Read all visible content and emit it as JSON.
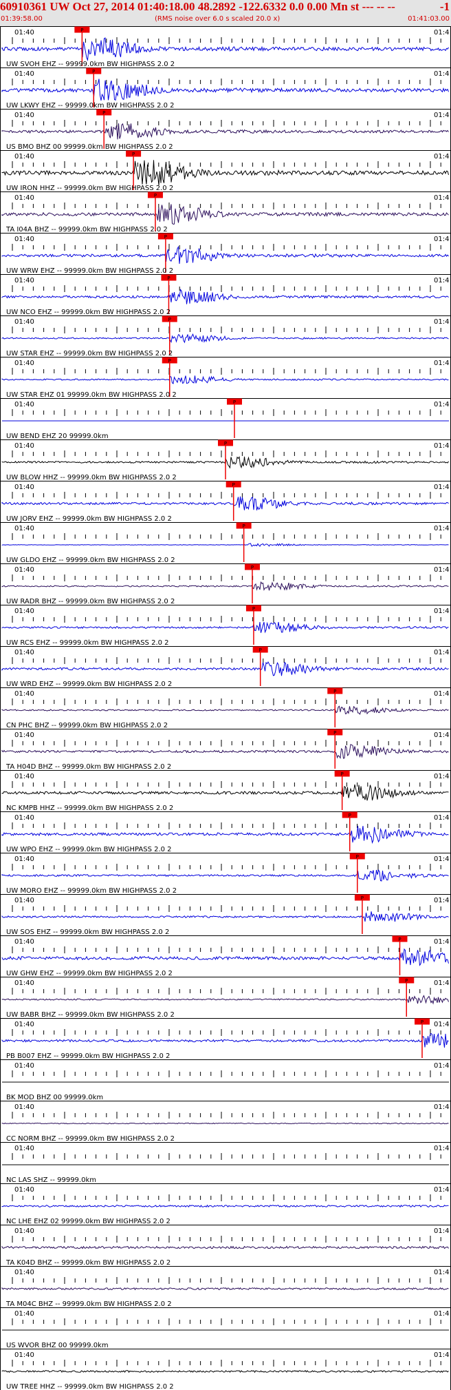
{
  "header": {
    "title": "60910361 UW Oct 27, 2014 01:40:18.00   48.2892 -122.6332  0.0 0.00 Mn st --- -- --",
    "title_right": "-1",
    "start_time": "01:39:58.00",
    "scale_note": "(RMS noise over 6.0 s scaled 20.0 x)",
    "end_time": "01:41:03.00"
  },
  "colors": {
    "blue": "#0000dd",
    "purple": "#2a0d5a",
    "black": "#000000",
    "pick": "#ee0000",
    "axis": "#000000"
  },
  "time_labels": {
    "left": "01:40",
    "right": "01:4"
  },
  "pick_label": "P",
  "chart_data": {
    "type": "line",
    "title": "60910361 UW Oct 27, 2014 01:40:18.00   48.2892 -122.6332  0.0 0.00 Mn st --- -- --",
    "x_range": [
      "01:39:58.00",
      "01:41:03.00"
    ],
    "series": [
      {
        "label": "UW SVOH EHZ -- 99999.0km BW  HIGHPASS  2.0  2",
        "color": "blue",
        "amp": 0.8,
        "pick_t": 0.179
      },
      {
        "label": "UW LKWY EHZ -- 99999.0km BW  HIGHPASS  2.0  2",
        "color": "blue",
        "amp": 0.8,
        "pick_t": 0.205
      },
      {
        "label": "US BMO BHZ 00 99999.0km BW  HIGHPASS  2.0  2",
        "color": "purple",
        "amp": 0.6,
        "pick_t": 0.228
      },
      {
        "label": "UW IRON HHZ -- 99999.0km BW  HIGHPASS  2.0  2",
        "color": "black",
        "amp": 0.9,
        "pick_t": 0.294
      },
      {
        "label": "TA I04A BHZ -- 99999.0km BW  HIGHPASS  2.0  2",
        "color": "purple",
        "amp": 0.7,
        "pick_t": 0.343
      },
      {
        "label": "UW WRW EHZ -- 99999.0km BW  HIGHPASS  2.0  2",
        "color": "blue",
        "amp": 0.6,
        "pick_t": 0.366
      },
      {
        "label": "UW NCO EHZ -- 99999.0km BW  HIGHPASS  2.0  2",
        "color": "blue",
        "amp": 0.5,
        "pick_t": 0.373
      },
      {
        "label": "UW STAR EHZ -- 99999.0km BW  HIGHPASS  2.0  2",
        "color": "blue",
        "amp": 0.3,
        "pick_t": 0.375
      },
      {
        "label": "UW STAR EHZ 01 99999.0km BW  HIGHPASS  2.0  2",
        "color": "blue",
        "amp": 0.3,
        "pick_t": 0.375
      },
      {
        "label": "UW BEND EHZ 20 99999.0km",
        "color": "blue",
        "amp": 0.0,
        "pick_t": 0.52
      },
      {
        "label": "UW BLOW HHZ -- 99999.0km BW  HIGHPASS  2.0  2",
        "color": "black",
        "amp": 0.4,
        "pick_t": 0.5
      },
      {
        "label": "UW JORV EHZ -- 99999.0km BW  HIGHPASS  2.0  2",
        "color": "blue",
        "amp": 0.5,
        "pick_t": 0.518
      },
      {
        "label": "UW GLDO EHZ -- 99999.0km BW  HIGHPASS  2.0  2",
        "color": "blue",
        "amp": 0.1,
        "pick_t": 0.541
      },
      {
        "label": "UW RADR BHZ -- 99999.0km BW  HIGHPASS  2.0  2",
        "color": "purple",
        "amp": 0.3,
        "pick_t": 0.56
      },
      {
        "label": "UW RCS EHZ -- 99999.0km BW  HIGHPASS  2.0  2",
        "color": "blue",
        "amp": 0.4,
        "pick_t": 0.563
      },
      {
        "label": "UW WRD EHZ -- 99999.0km BW  HIGHPASS  2.0  2",
        "color": "blue",
        "amp": 0.5,
        "pick_t": 0.578
      },
      {
        "label": "CN PHC BHZ -- 99999.0km BW  HIGHPASS  2.0  2",
        "color": "purple",
        "amp": 0.3,
        "pick_t": 0.745
      },
      {
        "label": "TA H04D BHZ -- 99999.0km BW  HIGHPASS  2.0  2",
        "color": "purple",
        "amp": 0.5,
        "pick_t": 0.745
      },
      {
        "label": "NC KMPB HHZ -- 99999.0km BW  HIGHPASS  2.0  2",
        "color": "black",
        "amp": 0.6,
        "pick_t": 0.761
      },
      {
        "label": "UW WPO EHZ -- 99999.0km BW  HIGHPASS  2.0  2",
        "color": "blue",
        "amp": 0.6,
        "pick_t": 0.778
      },
      {
        "label": "UW MORO EHZ -- 99999.0km BW  HIGHPASS  2.0  2",
        "color": "blue",
        "amp": 0.4,
        "pick_t": 0.795
      },
      {
        "label": "UW SOS EHZ -- 99999.0km BW  HIGHPASS  2.0  2",
        "color": "blue",
        "amp": 0.4,
        "pick_t": 0.806
      },
      {
        "label": "UW GHW EHZ -- 99999.0km BW  HIGHPASS  2.0  2",
        "color": "blue",
        "amp": 0.7,
        "pick_t": 0.89
      },
      {
        "label": "UW BABR BHZ -- 99999.0km BW  HIGHPASS  2.0  2",
        "color": "purple",
        "amp": 0.3,
        "pick_t": 0.905
      },
      {
        "label": "PB B007 EHZ -- 99999.0km BW  HIGHPASS  2.0  2",
        "color": "blue",
        "amp": 0.5,
        "pick_t": 0.94
      },
      {
        "label": "BK MOD BHZ 00 99999.0km",
        "color": "black",
        "amp": 0.0,
        "pick_t": null
      },
      {
        "label": "CC NORM BHZ -- 99999.0km BW  HIGHPASS  2.0  2",
        "color": "purple",
        "amp": 0.2,
        "pick_t": null
      },
      {
        "label": "NC LAS SHZ -- 99999.0km",
        "color": "black",
        "amp": 0.0,
        "pick_t": null
      },
      {
        "label": "NC LHE EHZ 02 99999.0km BW  HIGHPASS  2.0  2",
        "color": "blue",
        "amp": 0.4,
        "pick_t": null
      },
      {
        "label": "TA K04D BHZ -- 99999.0km BW  HIGHPASS  2.0  2",
        "color": "purple",
        "amp": 0.5,
        "pick_t": null
      },
      {
        "label": "TA M04C BHZ -- 99999.0km BW  HIGHPASS  2.0  2",
        "color": "purple",
        "amp": 0.4,
        "pick_t": null
      },
      {
        "label": "US WVOR BHZ 00 99999.0km",
        "color": "black",
        "amp": 0.0,
        "pick_t": null
      },
      {
        "label": "UW TREE HHZ -- 99999.0km BW  HIGHPASS  2.0  2",
        "color": "black",
        "amp": 0.4,
        "pick_t": null
      }
    ]
  }
}
